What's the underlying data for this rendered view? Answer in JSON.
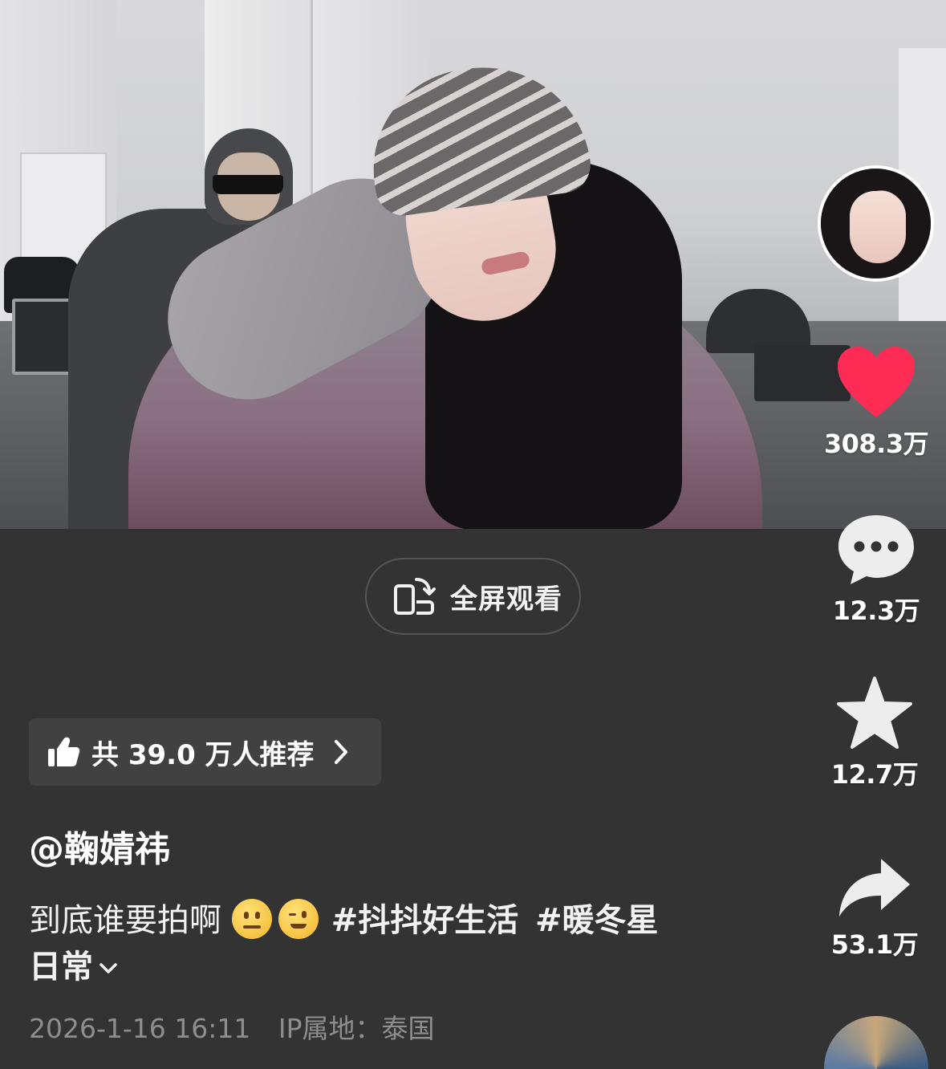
{
  "video": {
    "fullscreen_label": "全屏观看"
  },
  "rail": {
    "like_count": "308.3万",
    "comment_count": "12.3万",
    "favorite_count": "12.7万",
    "share_count": "53.1万",
    "like_color": "#fe2c55"
  },
  "recommend": {
    "label": "共 39.0 万人推荐"
  },
  "post": {
    "author": "@鞠婧祎",
    "caption_text": "到底谁要拍啊",
    "emojis": [
      "neutral-face-emoji",
      "winking-face-emoji"
    ],
    "hashtag_1": "#抖抖好生活",
    "hashtag_2": "#暖冬星",
    "hashtag_2_cont": "日常",
    "date": "2026-1-16 16:11",
    "ip_location": "IP属地：泰国"
  }
}
